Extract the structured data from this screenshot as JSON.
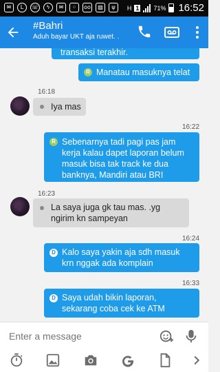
{
  "statusbar": {
    "network_label": "H",
    "sim_label": "1",
    "battery_percent": "71%",
    "time": "16:52",
    "notification_icons": [
      "mail-icon",
      "line-icon",
      "whatsapp-icon",
      "messenger-icon",
      "mail-icon",
      "blackberry-icon",
      "voicemail-icon",
      "image-icon",
      "usb-icon"
    ]
  },
  "header": {
    "title": "#Bahri",
    "subtitle": "Aduh bayar UKT aja ruwet. ."
  },
  "messages": [
    {
      "dir": "out",
      "badge": "R",
      "text": "transaksi terakhir."
    },
    {
      "dir": "out",
      "badge": "R",
      "text": "Manatau masuknya telat"
    },
    {
      "dir": "in",
      "time": "16:18",
      "text": "Iya mas"
    },
    {
      "dir": "out",
      "time": "16:22",
      "badge": "R",
      "lines": [
        "Sebenarnya tadi pagi pas jam",
        "kerja kalau dapet laporan belum",
        "masuk bisa tak track ke dua",
        "banknya, Mandiri atau BRI"
      ]
    },
    {
      "dir": "in",
      "time": "16:23",
      "lines": [
        "La saya juga gk tau mas. .yg",
        "ngirim kn sampeyan"
      ]
    },
    {
      "dir": "out",
      "time": "16:24",
      "badge": "D",
      "lines": [
        "Kalo saya yakin aja sdh masuk",
        "krn nggak ada komplain"
      ]
    },
    {
      "dir": "out",
      "time": "16:33",
      "badge": "D",
      "lines": [
        "Saya udah bikin laporan,",
        "sekarang coba cek ke ATM"
      ]
    }
  ],
  "composer": {
    "placeholder": "Enter a message"
  },
  "colors": {
    "appbar": "#1e88e5",
    "outgoing_bubble": "#1e9be9",
    "incoming_bubble": "#d9d9d9",
    "read_badge": "#9ccc65"
  }
}
